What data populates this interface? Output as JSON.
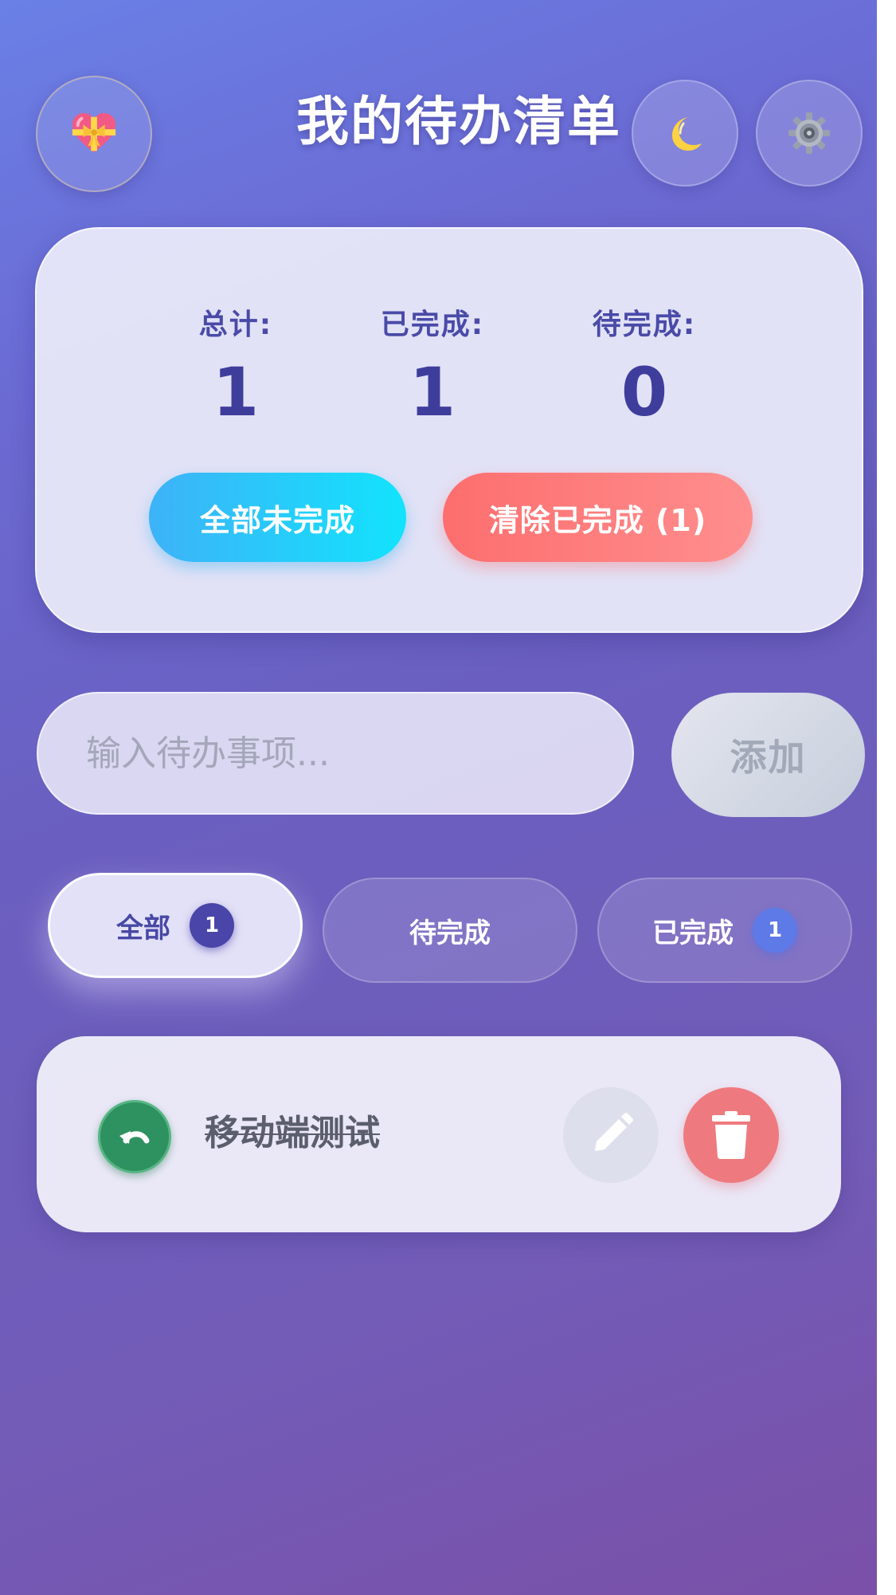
{
  "header": {
    "title": "我的待办清单",
    "avatar_icon": "heart-with-ribbon-icon",
    "theme_icon": "crescent-moon-icon",
    "settings_icon": "gear-icon"
  },
  "stats": {
    "total_label": "总计:",
    "total_value": "1",
    "done_label": "已完成:",
    "done_value": "1",
    "pending_label": "待完成:",
    "pending_value": "0",
    "mark_all_undone_label": "全部未完成",
    "clear_done_label": "清除已完成 (1)"
  },
  "input": {
    "value": "",
    "placeholder": "输入待办事项...",
    "add_label": "添加"
  },
  "filters": {
    "all_label": "全部",
    "all_count": "1",
    "pending_label": "待完成",
    "done_label": "已完成",
    "done_count": "1",
    "active": "all"
  },
  "todos": [
    {
      "text": "移动端测试",
      "completed": true,
      "toggle_icon": "undo-arrow-icon",
      "edit_icon": "pencil-icon",
      "delete_icon": "trash-icon"
    }
  ],
  "colors": {
    "background_start": "#6a80e6",
    "background_end": "#7a50a8",
    "accent_text": "#4a4aa8",
    "mark_undone_button": "#12e3fc",
    "clear_done_button": "#fd6e6e",
    "toggle_button": "#2e9160",
    "delete_button": "#ee7a7f"
  }
}
